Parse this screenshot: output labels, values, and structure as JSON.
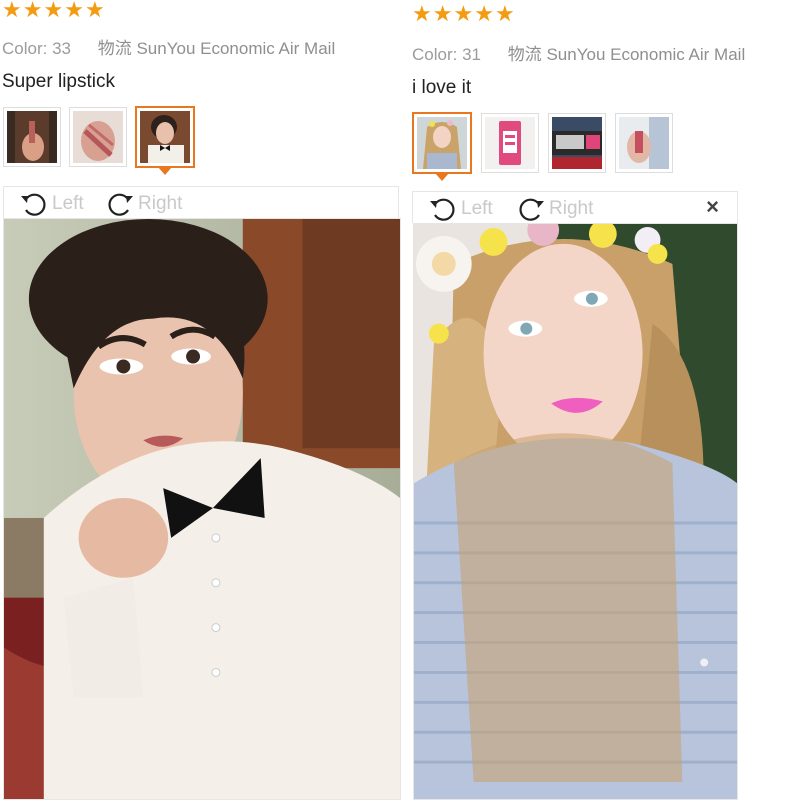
{
  "reviews": [
    {
      "rating": 5,
      "color_label": "Color:",
      "color_value": "33",
      "shipping": "物流 SunYou Economic Air Mail",
      "comment": "Super lipstick",
      "thumbnails": [
        "photo-lipstick-hand",
        "photo-lipstick-swatch",
        "photo-woman-bowtie"
      ],
      "active_thumb": 2,
      "rotate_left": "Left",
      "rotate_right": "Right"
    },
    {
      "rating": 5,
      "color_label": "Color:",
      "color_value": "31",
      "shipping": "物流 SunYou Economic Air Mail",
      "comment": "i love it",
      "thumbnails": [
        "photo-woman-flower-crown",
        "photo-matte-lipstick-box",
        "photo-matte-lipstick-tube",
        "photo-lipstick-window"
      ],
      "active_thumb": 0,
      "rotate_left": "Left",
      "rotate_right": "Right",
      "close": "×"
    }
  ],
  "colors": {
    "star": "#f39c12",
    "active_border": "#e8771f",
    "meta_text": "#9b9b9b",
    "toolbar_text": "#c9c9c9"
  }
}
